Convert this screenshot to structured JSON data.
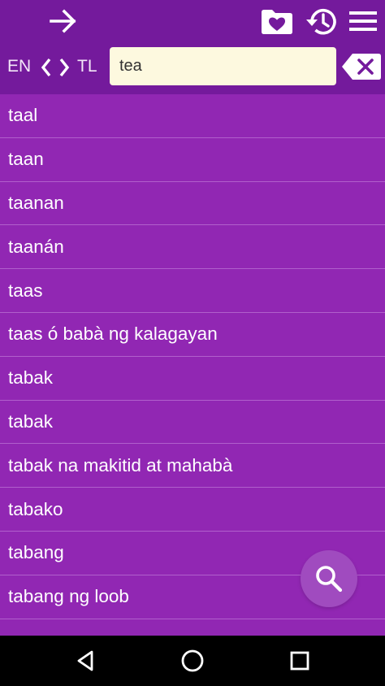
{
  "header": {
    "forward_icon": "arrow-right-icon",
    "favorites_icon": "folder-heart-icon",
    "history_icon": "history-icon",
    "menu_icon": "menu-icon"
  },
  "language_bar": {
    "source_lang": "EN",
    "target_lang": "TL",
    "swap_icon": "swap-chevrons-icon"
  },
  "search": {
    "value": "tea",
    "clear_icon": "backspace-clear-icon"
  },
  "words": [
    "taal",
    "taan",
    "taanan",
    "taanán",
    "taas",
    "taas ó babà ng kalagayan",
    "tabak",
    "tabak",
    "tabak na makitid at mahabà",
    "tabako",
    "tabang",
    "tabang ng loob"
  ],
  "fab": {
    "icon": "search-icon"
  },
  "colors": {
    "header_bg": "#741a9c",
    "list_bg": "#9127b3",
    "divider": "#b15fcc",
    "input_bg": "#fdf9df"
  },
  "navbar": {
    "back_icon": "nav-back-icon",
    "home_icon": "nav-home-icon",
    "recents_icon": "nav-recents-icon"
  }
}
